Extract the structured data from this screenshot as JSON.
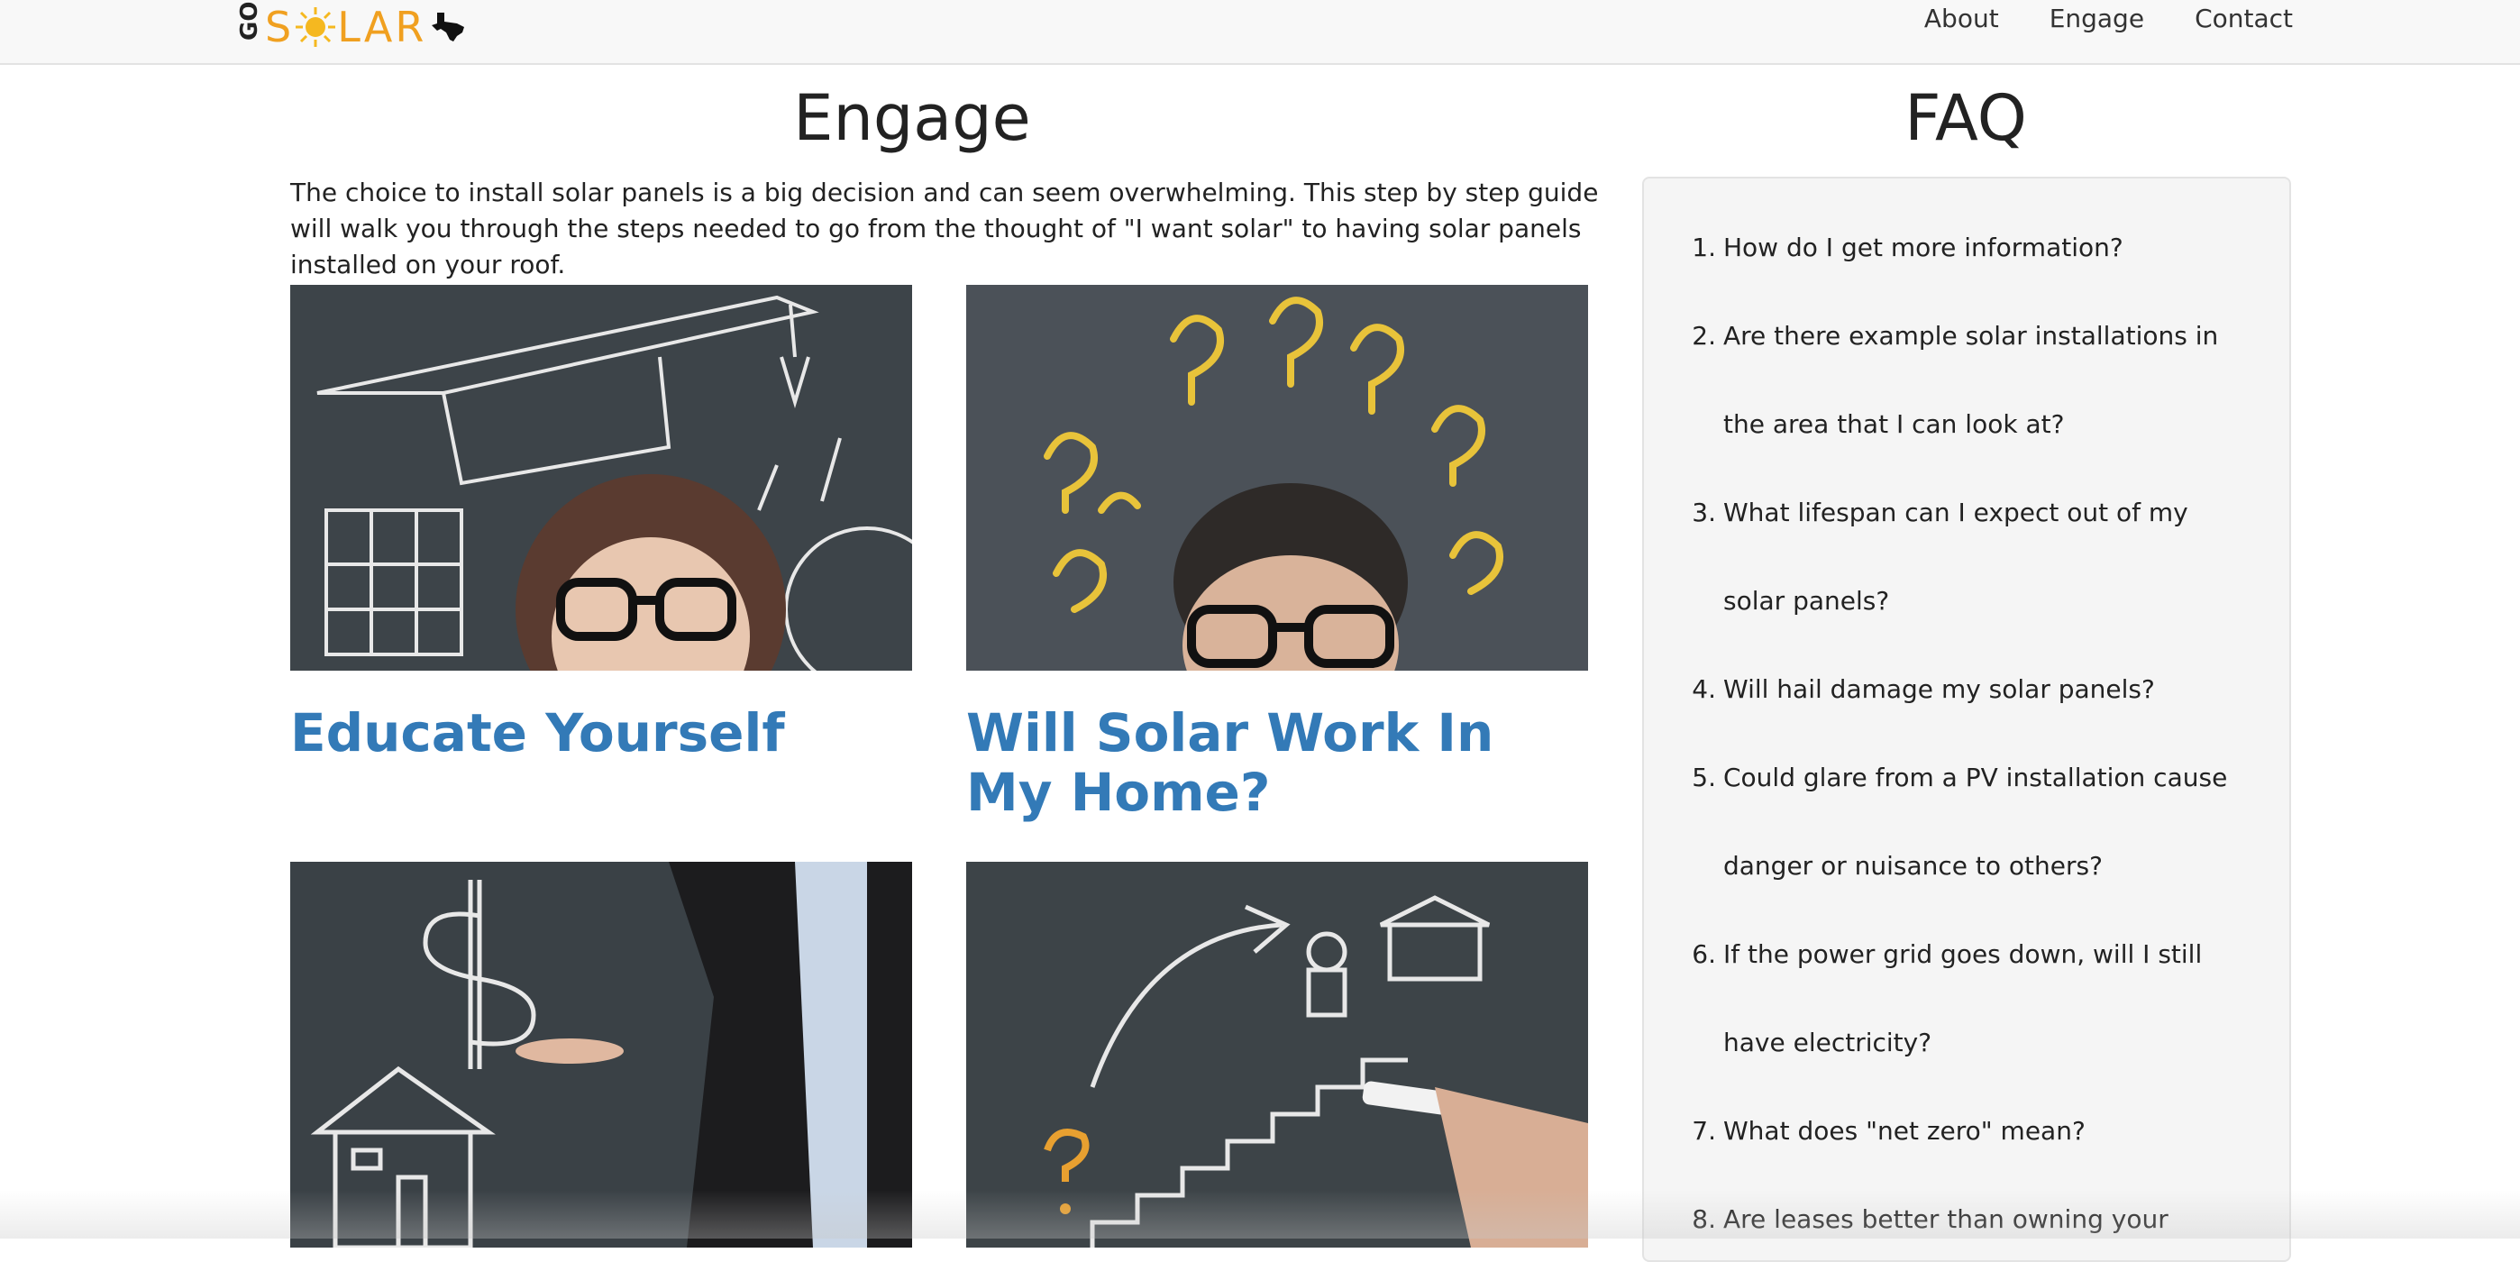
{
  "nav": {
    "logo_go": "GO",
    "logo_so": "S",
    "logo_lar": "LAR",
    "links": [
      "About",
      "Engage",
      "Contact"
    ]
  },
  "engage": {
    "title": "Engage",
    "intro": "The choice to install solar panels is a big decision and can seem overwhelming. This step by step guide will walk you through the steps needed to go from the thought of \"I want solar\" to having solar panels installed on your roof.",
    "cards": [
      {
        "title": "Educate Yourself"
      },
      {
        "title": "Will Solar Work In My Home?"
      }
    ]
  },
  "faq": {
    "title": "FAQ",
    "items": [
      {
        "num": "1.",
        "text": "How do I get more information?"
      },
      {
        "num": "2.",
        "text": "Are there example solar installations in the area that I can look at?"
      },
      {
        "num": "3.",
        "text": "What lifespan can I expect out of my solar panels?"
      },
      {
        "num": "4.",
        "text": "Will hail damage my solar panels?"
      },
      {
        "num": "5.",
        "text": "Could glare from a PV installation cause danger or nuisance to others?"
      },
      {
        "num": "6.",
        "text": "If the power grid goes down, will I still have electricity?"
      },
      {
        "num": "7.",
        "text": "What does \"net zero\" mean?"
      },
      {
        "num": "8.",
        "text": "Are leases better than owning your"
      }
    ]
  },
  "colors": {
    "link": "#337ab7",
    "logo": "#f0a020",
    "navbar": "#f8f8f8"
  }
}
